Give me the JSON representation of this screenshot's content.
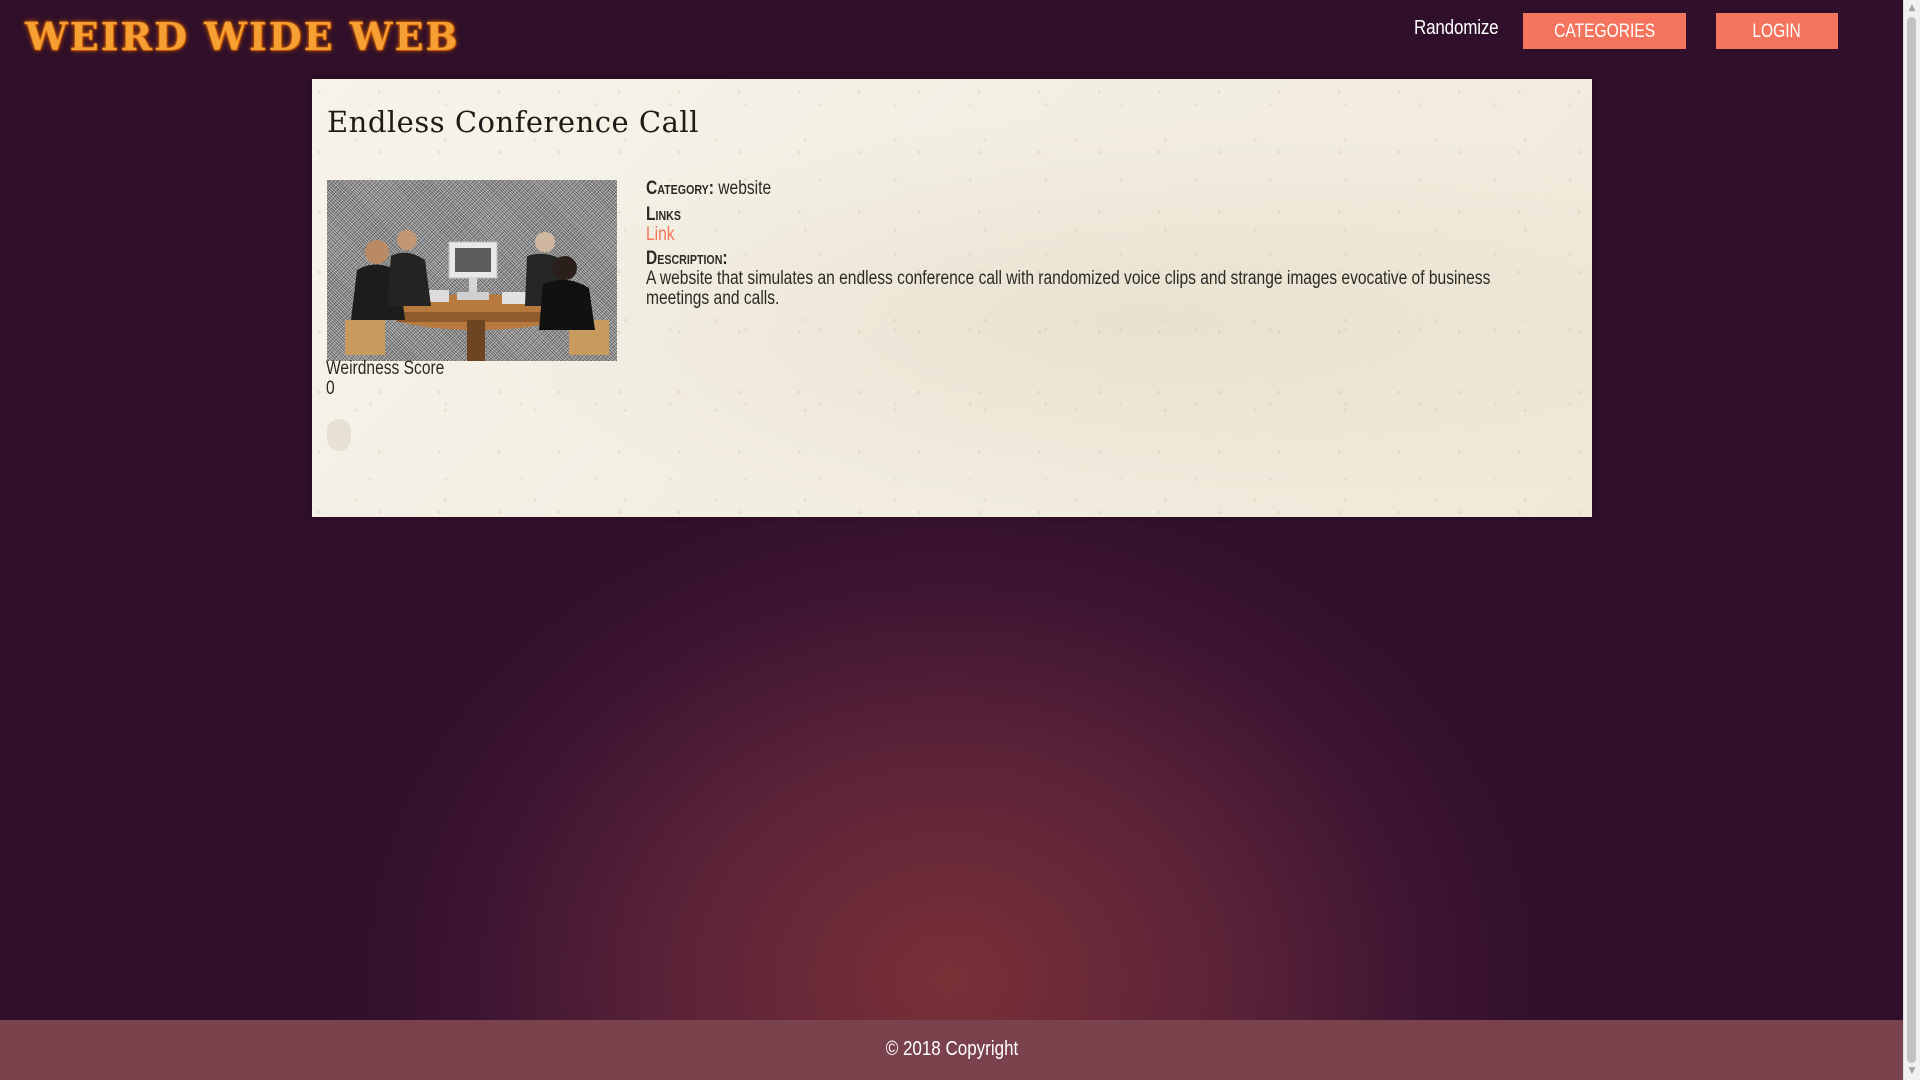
{
  "header": {
    "logo": "WEIRD WIDE WEB",
    "nav": {
      "randomize": "Randomize",
      "categories": "CATEGORIES",
      "login": "LOGIN"
    }
  },
  "entry": {
    "title": "Endless Conference Call",
    "image_alt": "business people at a conference table with a video screen",
    "weirdness_label": "Weirdness Score",
    "weirdness_value": "0",
    "category_label": "Category:",
    "category_value": "website",
    "links_label": "Links",
    "link_text": "Link",
    "description_label": "Description:",
    "description": "A website that simulates an endless conference call with randomized voice clips and strange images evocative of business meetings and calls."
  },
  "footer": {
    "copyright": "© 2018 Copyright"
  },
  "colors": {
    "accent": "#f4745e",
    "logo": "#f6a033",
    "footer_bg": "#7a424d",
    "card_bg": "#f3efe3"
  }
}
